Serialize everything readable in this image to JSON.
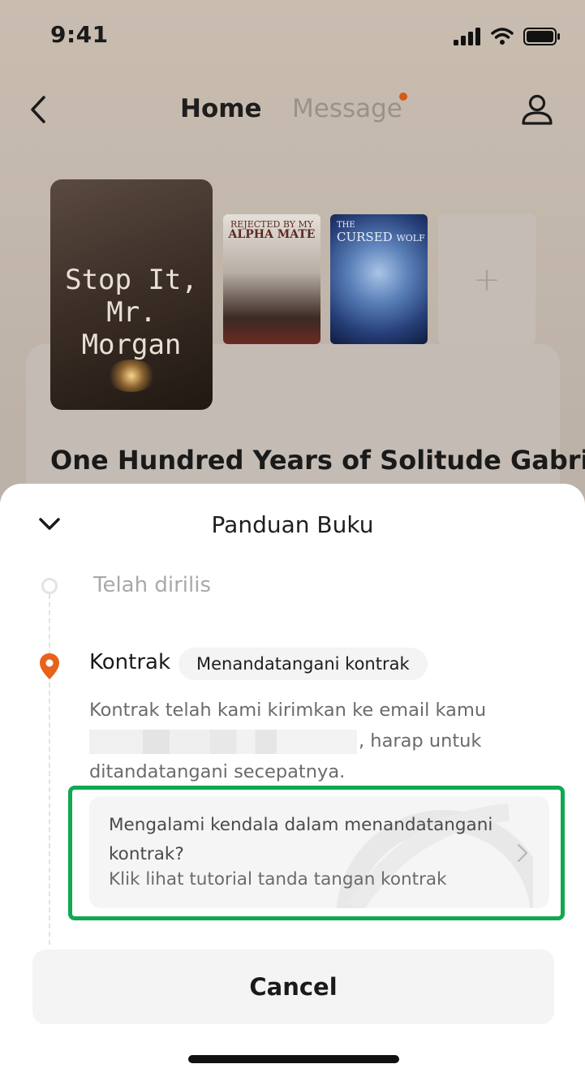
{
  "status_bar": {
    "time": "9:41"
  },
  "nav": {
    "home_label": "Home",
    "message_label": "Message"
  },
  "shelf": {
    "books": [
      {
        "title": "Stop It, Mr. Morgan"
      },
      {
        "title_small": "REJECTED BY MY",
        "title_big": "ALPHA MATE"
      },
      {
        "title_line1": "THE",
        "title_line2": "CURSED",
        "title_line3": "WOLF"
      }
    ],
    "add_symbol": "+",
    "current_book_title": "One Hundred Years of Solitude Gabri"
  },
  "sheet": {
    "title": "Panduan Buku",
    "steps": [
      {
        "label": "Telah dirilis"
      },
      {
        "label": "Kontrak",
        "badge": "Menandatangani kontrak"
      }
    ],
    "description_line1": "Kontrak telah kami kirimkan ke email kamu",
    "description_line2_suffix": ", harap untuk",
    "description_line3": "ditandatangani secepatnya.",
    "help": {
      "question": "Mengalami kendala dalam menandatangani kontrak?",
      "link": "Klik lihat tutorial tanda tangan kontrak"
    },
    "cancel_label": "Cancel"
  },
  "colors": {
    "accent_orange": "#e8631a",
    "highlight_green": "#10a852"
  },
  "icons": [
    "back-icon",
    "profile-icon",
    "chevron-down-icon",
    "location-pin-icon",
    "chevron-right-icon"
  ]
}
